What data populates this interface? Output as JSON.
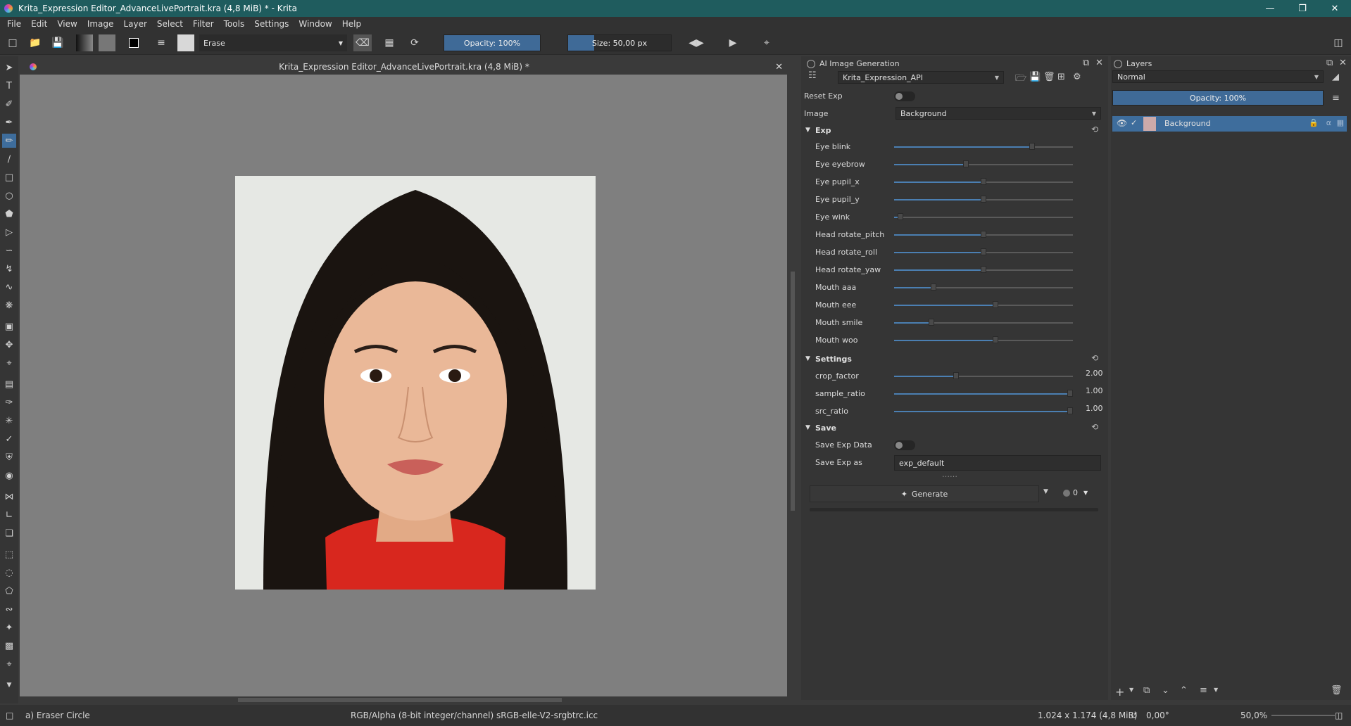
{
  "window": {
    "title": "Krita_Expression Editor_AdvanceLivePortrait.kra (4,8 MiB) * - Krita"
  },
  "menu": [
    "File",
    "Edit",
    "View",
    "Image",
    "Layer",
    "Select",
    "Filter",
    "Tools",
    "Settings",
    "Window",
    "Help"
  ],
  "toolbar": {
    "preset": "Erase",
    "opacity": "Opacity: 100%",
    "opacity_fraction": 1.0,
    "size": "Size: 50,00 px",
    "size_fraction": 0.25
  },
  "document": {
    "tab_title": "Krita_Expression Editor_AdvanceLivePortrait.kra (4,8 MiB) *"
  },
  "ai_panel": {
    "title": "AI Image Generation",
    "workflow": "Krita_Expression_API",
    "reset_exp_label": "Reset Exp",
    "image_label": "Image",
    "image_value": "Background",
    "exp_section": "Exp",
    "sliders": [
      {
        "label": "Eye blink",
        "value": 0.78
      },
      {
        "label": "Eye eyebrow",
        "value": 0.4
      },
      {
        "label": "Eye pupil_x",
        "value": 0.5
      },
      {
        "label": "Eye pupil_y",
        "value": 0.5
      },
      {
        "label": "Eye wink",
        "value": 0.02
      },
      {
        "label": "Head rotate_pitch",
        "value": 0.5
      },
      {
        "label": "Head rotate_roll",
        "value": 0.5
      },
      {
        "label": "Head rotate_yaw",
        "value": 0.5
      },
      {
        "label": "Mouth aaa",
        "value": 0.21
      },
      {
        "label": "Mouth eee",
        "value": 0.57
      },
      {
        "label": "Mouth smile",
        "value": 0.2
      },
      {
        "label": "Mouth woo",
        "value": 0.57
      }
    ],
    "settings_section": "Settings",
    "settings": [
      {
        "label": "crop_factor",
        "value": 0.34,
        "text": "2.00"
      },
      {
        "label": "sample_ratio",
        "value": 1.0,
        "text": "1.00"
      },
      {
        "label": "src_ratio",
        "value": 1.0,
        "text": "1.00"
      }
    ],
    "save_section": "Save",
    "save_exp_data_label": "Save Exp Data",
    "save_exp_as_label": "Save Exp as",
    "save_exp_as_value": "exp_default",
    "generate_label": "Generate",
    "queue_count": "0"
  },
  "layers_panel": {
    "title": "Layers",
    "blend_mode": "Normal",
    "opacity": "Opacity:  100%",
    "layer_name": "Background"
  },
  "status": {
    "tool": "a) Eraser Circle",
    "colorspace": "RGB/Alpha (8-bit integer/channel)  sRGB-elle-V2-srgbtrc.icc",
    "dimensions": "1.024 x 1.174 (4,8 MiB)",
    "rotation": "0,00°",
    "zoom": "50,0%"
  }
}
